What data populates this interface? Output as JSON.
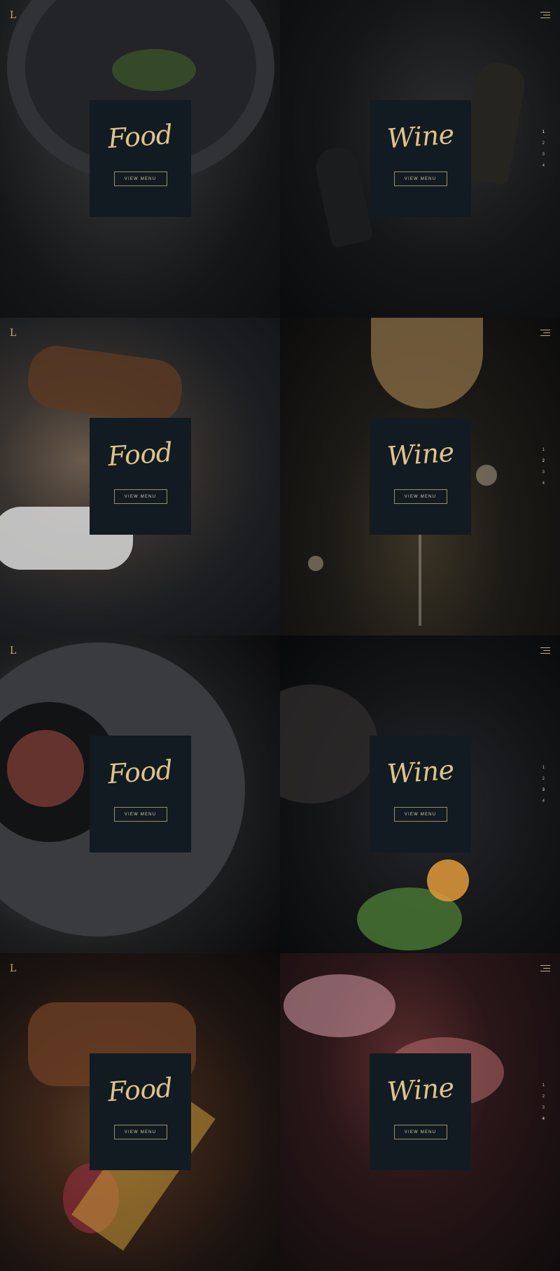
{
  "logo": {
    "mark": "L"
  },
  "panels": [
    {
      "food_title": "Food",
      "food_button": "VIEW MENU",
      "wine_title": "Wine",
      "wine_button": "VIEW MENU",
      "pages": [
        "1",
        "2",
        "3",
        "4"
      ]
    },
    {
      "food_title": "Food",
      "food_button": "VIEW MENU",
      "wine_title": "Wine",
      "wine_button": "VIEW MENU",
      "pages": [
        "1",
        "2",
        "3",
        "4"
      ]
    },
    {
      "food_title": "Food",
      "food_button": "VIEW MENU",
      "wine_title": "Wine",
      "wine_button": "VIEW MENU",
      "pages": [
        "1",
        "2",
        "3",
        "4"
      ]
    },
    {
      "food_title": "Food",
      "food_button": "VIEW MENU",
      "wine_title": "Wine",
      "wine_button": "VIEW MENU",
      "pages": [
        "1",
        "2",
        "3",
        "4"
      ]
    }
  ],
  "colors": {
    "card": "#121b22",
    "accent": "#dec38a",
    "text_light": "#d6c9a8"
  },
  "icons": {
    "menu": "hamburger-icon",
    "logo": "logo-icon"
  }
}
